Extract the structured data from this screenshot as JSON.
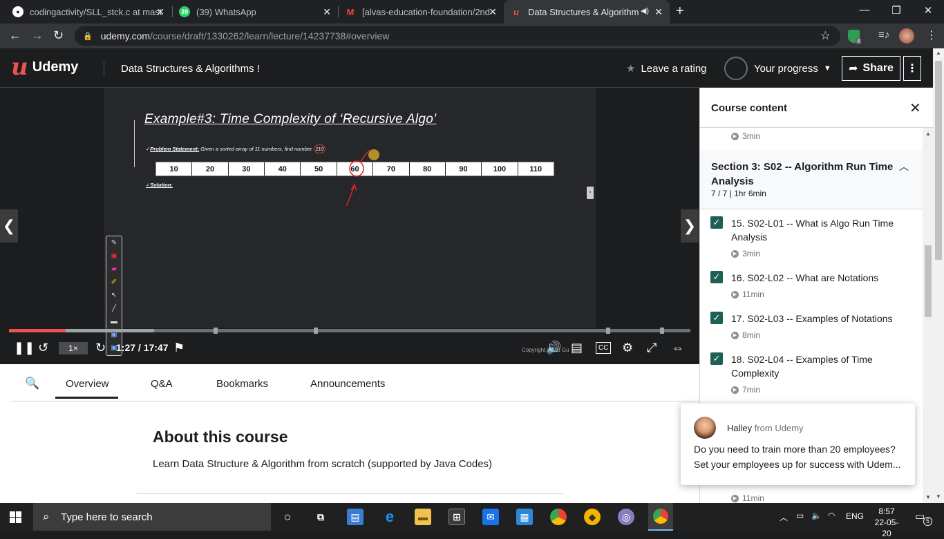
{
  "browser": {
    "tabs": [
      {
        "title": "codingactivity/SLL_stck.c at mast",
        "icon": "github-icon",
        "color": "#ffffff"
      },
      {
        "title": "(39) WhatsApp",
        "icon": "whatsapp-icon",
        "color": "#25d366"
      },
      {
        "title": "[alvas-education-foundation/2nd",
        "icon": "gmail-icon",
        "color": "#ea4335"
      },
      {
        "title": "Data Structures & Algorithm",
        "icon": "udemy-icon",
        "color": "#ec5252"
      }
    ],
    "whatsapp_badge": "39",
    "url_host": "udemy.com",
    "url_path": "/course/draft/1330262/learn/lecture/14237738#overview",
    "extension_badge": "4"
  },
  "header": {
    "logo_text": "Udemy",
    "course_title": "Data Structures & Algorithms !",
    "leave_rating": "Leave a rating",
    "your_progress": "Your progress",
    "share": "Share"
  },
  "video": {
    "slide_title": "Example#3: Time Complexity of ‘Recursive Algo’",
    "problem_label": "Problem Statement:",
    "problem_text": " Given a sorted array of 11 numbers, find number ",
    "problem_target": "110",
    "solution_label": "Solution:",
    "array_values": [
      "10",
      "20",
      "30",
      "40",
      "50",
      "60",
      "70",
      "80",
      "90",
      "100",
      "110"
    ],
    "progress_played_fraction": 0.083,
    "progress_buffer_fraction": 0.213,
    "speed": "1×",
    "time": "1:27 / 17:47",
    "copyright": "Copyright © DS Gu"
  },
  "content_tabs": {
    "tabs": [
      "Overview",
      "Q&A",
      "Bookmarks",
      "Announcements"
    ],
    "about_title": "About this course",
    "about_desc": "Learn Data Structure & Algorithm from scratch (supported by Java Codes)"
  },
  "sidebar": {
    "title": "Course content",
    "prev_duration": "3min",
    "section_title": "Section 3: S02 -- Algorithm Run Time Analysis",
    "section_meta": "7 / 7 | 1hr 6min",
    "lectures": [
      {
        "name": "15. S02-L01 -- What is Algo Run Time Analysis",
        "duration": "3min"
      },
      {
        "name": "16. S02-L02 -- What are Notations",
        "duration": "11min"
      },
      {
        "name": "17. S02-L03 -- Examples of Notations",
        "duration": "8min"
      },
      {
        "name": "18. S02-L04 -- Examples of Time Complexity",
        "duration": "7min"
      }
    ],
    "last_duration": "11min"
  },
  "chat": {
    "name": "Halley",
    "from": " from Udemy",
    "message": "Do you need to train more than 20 employees? Set your employees up for success with Udem..."
  },
  "taskbar": {
    "search_placeholder": "Type here to search",
    "language": "ENG",
    "time": "8:57",
    "date": "22-05-20",
    "notifications": "5"
  }
}
